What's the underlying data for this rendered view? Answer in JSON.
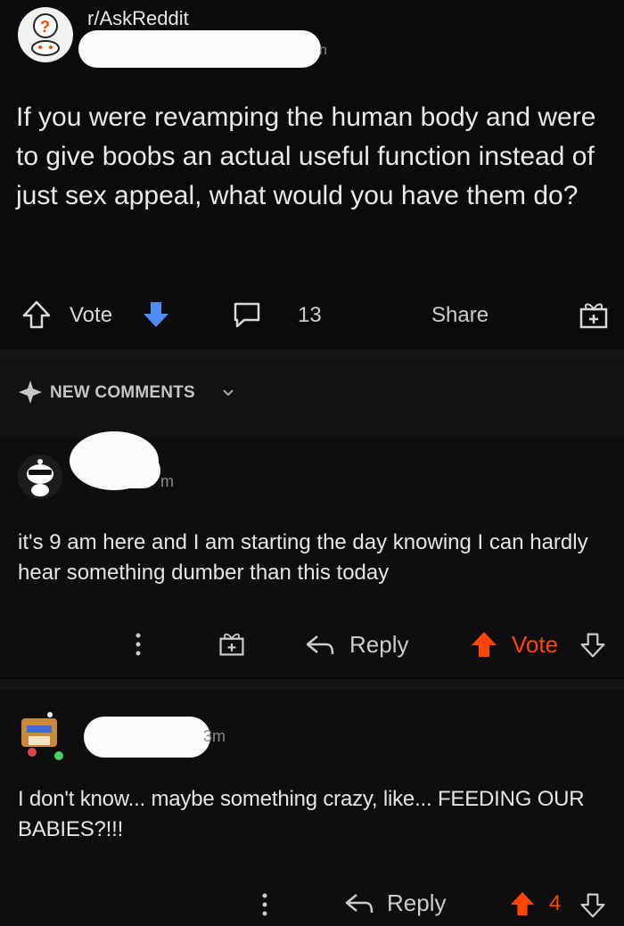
{
  "post": {
    "subreddit": "r/AskReddit",
    "meta_tail": "n",
    "title": "If you were revamping the human body and were to give boobs an actual useful function instead of just sex appeal, what would you have them do?",
    "vote_label": "Vote",
    "comment_count": "13",
    "share_label": "Share"
  },
  "new_comments": {
    "label": "NEW COMMENTS"
  },
  "comments": [
    {
      "time": "m",
      "text": "it's 9 am here and I am starting the day knowing I can hardly hear something dumber than this today",
      "reply_label": "Reply",
      "vote_label": "Vote"
    },
    {
      "time": "3m",
      "text": "I don't know... maybe something crazy, like... FEEDING OUR BABIES?!!!",
      "reply_label": "Reply",
      "vote_count": "4"
    }
  ],
  "colors": {
    "accent_orange": "#ff4500",
    "vote_blue": "#4f8df6",
    "background": "#0b0b0b"
  }
}
